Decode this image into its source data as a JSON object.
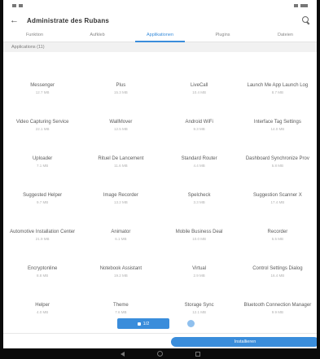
{
  "status_bar": {
    "left": "",
    "right": ""
  },
  "header": {
    "back_icon": "arrow-back-icon",
    "title": "Administrate des Rubans",
    "search_icon": "search-icon"
  },
  "tabs": [
    {
      "label": "Funktion"
    },
    {
      "label": "Aufkleb"
    },
    {
      "label": "Applikationen"
    },
    {
      "label": "Plugins"
    },
    {
      "label": "Dateien"
    }
  ],
  "section": {
    "title": "Applications (11)",
    "right": ""
  },
  "apps": [
    {
      "name": "Messenger",
      "size": "12.7 MB"
    },
    {
      "name": "Plus",
      "size": "15.3 MB"
    },
    {
      "name": "LiveCall",
      "size": "10.4 MB"
    },
    {
      "name": "Launch Me App Launch Log",
      "size": "8.7 MB"
    },
    {
      "name": "Video Capturing Service",
      "size": "22.1 MB"
    },
    {
      "name": "WallMover",
      "size": "12.5 MB"
    },
    {
      "name": "Android WiFi",
      "size": "9.3 MB"
    },
    {
      "name": "Interface Tag Settings",
      "size": "14.0 MB"
    },
    {
      "name": "Uploader",
      "size": "7.1 MB"
    },
    {
      "name": "Rituel De Lancement",
      "size": "11.6 MB"
    },
    {
      "name": "Standard Router",
      "size": "4.4 MB"
    },
    {
      "name": "Dashboard Synchronize Prov",
      "size": "5.8 MB"
    },
    {
      "name": "Suggested Helper",
      "size": "9.7 MB"
    },
    {
      "name": "Image Recorder",
      "size": "13.2 MB"
    },
    {
      "name": "Spelcheck",
      "size": "3.3 MB"
    },
    {
      "name": "Suggestion Scanner X",
      "size": "17.4 MB"
    },
    {
      "name": "Automotive Installation Center",
      "size": "21.9 MB"
    },
    {
      "name": "Animator",
      "size": "6.1 MB"
    },
    {
      "name": "Mobile Business Deal",
      "size": "10.0 MB"
    },
    {
      "name": "Recorder",
      "size": "5.5 MB"
    },
    {
      "name": "Encryptonline",
      "size": "8.8 MB"
    },
    {
      "name": "Notebook Assistant",
      "size": "19.2 MB"
    },
    {
      "name": "Virtual",
      "size": "2.9 MB"
    },
    {
      "name": "Control Settings Dialog",
      "size": "16.4 MB"
    },
    {
      "name": "Helper",
      "size": "4.0 MB"
    },
    {
      "name": "Theme",
      "size": "7.6 MB"
    },
    {
      "name": "Storage Sync",
      "size": "12.1 MB"
    },
    {
      "name": "Bluetooth Connection Manager",
      "size": "9.9 MB"
    }
  ],
  "pager": {
    "current_label": "1/2"
  },
  "action_button": {
    "label": "Installieren"
  },
  "colors": {
    "accent": "#3a8ddb",
    "accent_light": "#8fc0ee",
    "nav_bar": "#0b0b0b"
  }
}
